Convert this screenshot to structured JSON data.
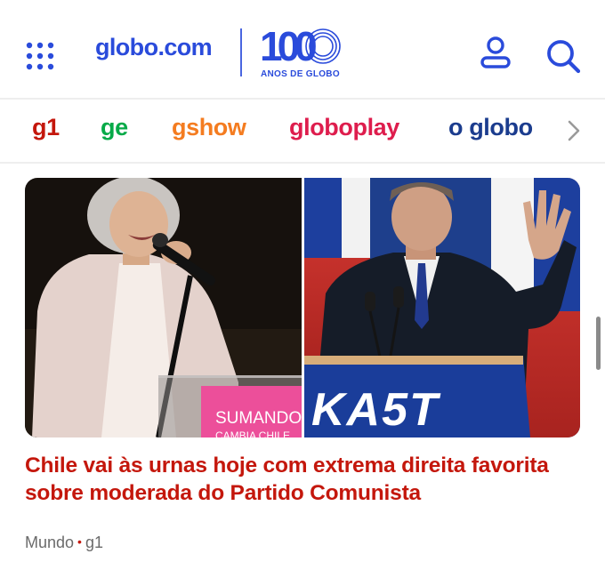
{
  "header": {
    "logo_text": "globo.com",
    "anniversary_number": "100",
    "anniversary_caption": "ANOS DE GLOBO",
    "icons": {
      "menu": "apps-grid-icon",
      "user": "user-icon",
      "search": "search-icon"
    }
  },
  "nav": {
    "items": [
      {
        "label": "g1",
        "color": "#c4170c"
      },
      {
        "label": "ge",
        "color": "#06aa48"
      },
      {
        "label": "gshow",
        "color": "#f47c20"
      },
      {
        "label": "globoplay",
        "color": "#de1d4d"
      },
      {
        "label": "o globo",
        "color": "#1b3c8e"
      }
    ],
    "more_icon": "chevron-right-icon"
  },
  "hero": {
    "left_podium_text_line1": "SUMANDO",
    "left_podium_text_line2": "CAMBIA CHILE",
    "right_podium_text": "KA5T"
  },
  "article": {
    "headline": "Chile vai às urnas hoje com extrema direita favorita sobre moderada do Partido Comunista",
    "section": "Mundo",
    "separator": "•",
    "source": "g1"
  },
  "colors": {
    "brand_blue": "#2a4bdb",
    "headline_red": "#c4170c",
    "meta_gray": "#6b6b6b"
  }
}
